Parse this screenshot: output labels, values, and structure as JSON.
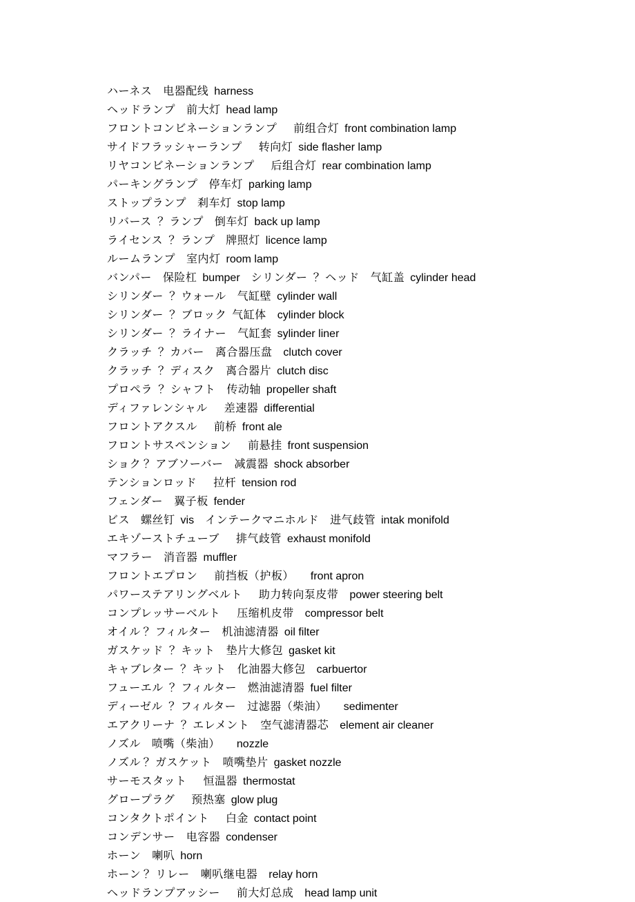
{
  "entries": [
    {
      "jp": "ハーネス",
      "zh": "电器配线",
      "en": "harness",
      "gap1": "m",
      "gap2": "s"
    },
    {
      "jp": "ヘッドランプ",
      "zh": "前大灯",
      "en": "head lamp",
      "gap1": "m",
      "gap2": "s"
    },
    {
      "jp": "フロントコンビネーションランプ",
      "zh": "前组合灯",
      "en": "front combination lamp",
      "gap1": "l",
      "gap2": "s"
    },
    {
      "jp": "サイドフラッシャーランプ",
      "zh": "转向灯",
      "en": "side flasher lamp",
      "gap1": "l",
      "gap2": "s"
    },
    {
      "jp": "リヤコンビネーションランプ",
      "zh": "后组合灯",
      "en": "rear combination lamp",
      "gap1": "l",
      "gap2": "s"
    },
    {
      "jp": "パーキングランプ",
      "zh": "停车灯",
      "en": "parking lamp",
      "gap1": "m",
      "gap2": "s"
    },
    {
      "jp": "ストップランプ",
      "zh": "刹车灯",
      "en": "stop lamp",
      "gap1": "m",
      "gap2": "s"
    },
    {
      "jp": "リバース ？ ランプ",
      "zh": "倒车灯",
      "en": "back up lamp",
      "gap1": "m",
      "gap2": "s"
    },
    {
      "jp": "ライセンス ？ ランプ",
      "zh": "牌照灯",
      "en": "licence lamp",
      "gap1": "m",
      "gap2": "s"
    },
    {
      "jp": "ルームランプ",
      "zh": "室内灯",
      "en": "room lamp",
      "gap1": "m",
      "gap2": "s"
    },
    {
      "jp": "バンパー",
      "zh": "保险杠",
      "en": "bumper",
      "gap1": "m",
      "gap2": "s",
      "extra": {
        "jp": "シリンダー ？ ヘッド",
        "zh": "气缸盖",
        "en": "cylinder head"
      }
    },
    {
      "jp": "シリンダー ？ ウォール",
      "zh": "气缸壁",
      "en": "cylinder wall",
      "gap1": "m",
      "gap2": "s"
    },
    {
      "jp": "シリンダー ？ ブロック",
      "zh": "气缸体",
      "en": "cylinder block",
      "gap1": "s",
      "gap2": "m",
      "zhjoin": true
    },
    {
      "jp": "シリンダー ？ ライナー",
      "zh": "气缸套",
      "en": "sylinder liner",
      "gap1": "m",
      "gap2": "s"
    },
    {
      "jp": "クラッチ ？ カバー",
      "zh": "离合器压盘",
      "en": "clutch cover",
      "gap1": "m",
      "gap2": "m"
    },
    {
      "jp": "クラッチ ？ ディスク",
      "zh": "离合器片",
      "en": "clutch disc",
      "gap1": "m",
      "gap2": "s"
    },
    {
      "jp": "プロペラ ？ シャフト",
      "zh": "传动轴",
      "en": "propeller shaft",
      "gap1": "m",
      "gap2": "s"
    },
    {
      "jp": "ディファレンシャル",
      "zh": "差速器",
      "en": "differential",
      "gap1": "l",
      "gap2": "s"
    },
    {
      "jp": "フロントアクスル",
      "zh": "前桥",
      "en": "front ale",
      "gap1": "l",
      "gap2": "s"
    },
    {
      "jp": "フロントサスペンション",
      "zh": "前悬挂",
      "en": "front suspension",
      "gap1": "l",
      "gap2": "s"
    },
    {
      "jp": "ショク？ アブソーバー",
      "zh": "减震器",
      "en": "shock absorber",
      "gap1": "m",
      "gap2": "s"
    },
    {
      "jp": "テンションロッド",
      "zh": "拉杆",
      "en": "tension rod",
      "gap1": "l",
      "gap2": "s"
    },
    {
      "jp": "フェンダー",
      "zh": "翼子板",
      "en": "fender",
      "gap1": "m",
      "gap2": "s"
    },
    {
      "jp": "ビス",
      "zh": "螺丝钉",
      "en": "vis",
      "gap1": "m",
      "gap2": "s",
      "extra": {
        "jp": "インテークマニホルド",
        "zh": "进气歧管",
        "en": "intak monifold"
      }
    },
    {
      "jp": "エキゾーストチューブ",
      "zh": "排气歧管",
      "en": "exhaust monifold",
      "gap1": "l",
      "gap2": "s"
    },
    {
      "jp": "マフラー",
      "zh": "消音器",
      "en": "muffler",
      "gap1": "m",
      "gap2": "s"
    },
    {
      "jp": "フロントエプロン",
      "zh": "前挡板（护板）",
      "en": "front apron",
      "gap1": "l",
      "gap2": "l"
    },
    {
      "jp": "パワーステアリングベルト",
      "zh": "助力转向泵皮带",
      "en": "power steering belt",
      "gap1": "l",
      "gap2": "m"
    },
    {
      "jp": "コンプレッサーベルト",
      "zh": "压缩机皮带",
      "en": "compressor belt",
      "gap1": "l",
      "gap2": "m"
    },
    {
      "jp": "オイル？ フィルター",
      "zh": "机油滤清器",
      "en": "oil filter",
      "gap1": "m",
      "gap2": "s"
    },
    {
      "jp": "ガスケッド ？ キット",
      "zh": "垫片大修包",
      "en": "gasket kit",
      "gap1": "m",
      "gap2": "s"
    },
    {
      "jp": "キャブレター ？ キット",
      "zh": "化油器大修包",
      "en": "carbuertor",
      "gap1": "m",
      "gap2": "m"
    },
    {
      "jp": "フューエル ？ フィルター",
      "zh": "燃油滤清器",
      "en": "fuel filter",
      "gap1": "m",
      "gap2": "s"
    },
    {
      "jp": "ディーゼル ？ フィルター",
      "zh": "过滤器（柴油）",
      "en": "sedimenter",
      "gap1": "m",
      "gap2": "l"
    },
    {
      "jp": "エアクリーナ ？ エレメント",
      "zh": "空气滤清器芯",
      "en": "element air cleaner",
      "gap1": "m",
      "gap2": "m"
    },
    {
      "jp": "ノズル",
      "zh": "喷嘴（柴油）",
      "en": "nozzle",
      "gap1": "m",
      "gap2": "l"
    },
    {
      "jp": "ノズル？ ガスケット",
      "zh": "喷嘴垫片",
      "en": "gasket nozzle",
      "gap1": "m",
      "gap2": "s"
    },
    {
      "jp": "サーモスタット",
      "zh": "恒温器",
      "en": "thermostat",
      "gap1": "l",
      "gap2": "s"
    },
    {
      "jp": "グロープラグ",
      "zh": "预热塞",
      "en": "glow plug",
      "gap1": "l",
      "gap2": "s"
    },
    {
      "jp": "コンタクトポイント",
      "zh": "白金",
      "en": "contact point",
      "gap1": "l",
      "gap2": "s"
    },
    {
      "jp": "コンデンサー",
      "zh": "电容器",
      "en": "condenser",
      "gap1": "m",
      "gap2": "s"
    },
    {
      "jp": "ホーン",
      "zh": "喇叭",
      "en": "horn",
      "gap1": "m",
      "gap2": "s"
    },
    {
      "jp": "ホーン？ リレー",
      "zh": "喇叭继电器",
      "en": "relay horn",
      "gap1": "m",
      "gap2": "m"
    },
    {
      "jp": "ヘッドランプアッシー",
      "zh": "前大灯总成",
      "en": "head lamp unit",
      "gap1": "l",
      "gap2": "m"
    }
  ]
}
